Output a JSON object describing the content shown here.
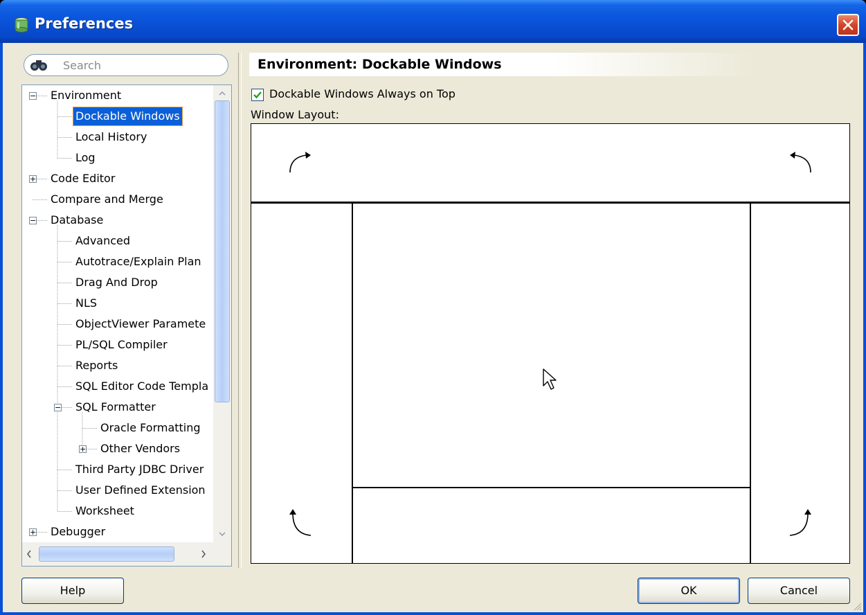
{
  "window": {
    "title": "Preferences",
    "close_symbol": "✕"
  },
  "search": {
    "placeholder": "Search"
  },
  "tree": {
    "items": [
      {
        "label": "Environment",
        "level": 0,
        "expander": "minus"
      },
      {
        "label": "Dockable Windows",
        "level": 1,
        "selected": true
      },
      {
        "label": "Local History",
        "level": 1
      },
      {
        "label": "Log",
        "level": 1
      },
      {
        "label": "Code Editor",
        "level": 0,
        "expander": "plus"
      },
      {
        "label": "Compare and Merge",
        "level": 0
      },
      {
        "label": "Database",
        "level": 0,
        "expander": "minus"
      },
      {
        "label": "Advanced",
        "level": 1
      },
      {
        "label": "Autotrace/Explain Plan",
        "level": 1
      },
      {
        "label": "Drag And Drop",
        "level": 1
      },
      {
        "label": "NLS",
        "level": 1
      },
      {
        "label": "ObjectViewer Paramete",
        "level": 1
      },
      {
        "label": "PL/SQL Compiler",
        "level": 1
      },
      {
        "label": "Reports",
        "level": 1
      },
      {
        "label": "SQL Editor Code Templa",
        "level": 1
      },
      {
        "label": "SQL Formatter",
        "level": 1,
        "expander": "minus"
      },
      {
        "label": "Oracle Formatting",
        "level": 2
      },
      {
        "label": "Other Vendors",
        "level": 2,
        "expander": "plus"
      },
      {
        "label": "Third Party JDBC Driver",
        "level": 1
      },
      {
        "label": "User Defined Extension",
        "level": 1
      },
      {
        "label": "Worksheet",
        "level": 1
      },
      {
        "label": "Debugger",
        "level": 0,
        "expander": "plus"
      }
    ]
  },
  "panel": {
    "title": "Environment: Dockable Windows",
    "always_on_top": {
      "label": "Dockable Windows Always on Top",
      "checked": true
    },
    "layout_label": "Window Layout:"
  },
  "buttons": {
    "help": "Help",
    "ok": "OK",
    "cancel": "Cancel"
  }
}
